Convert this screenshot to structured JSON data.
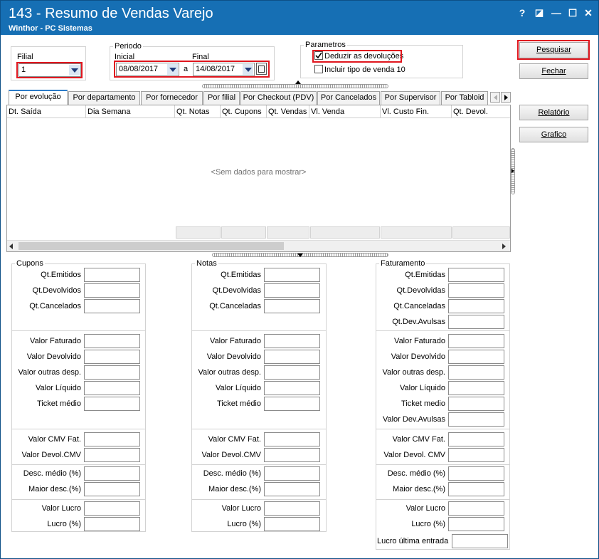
{
  "window": {
    "title": "143 - Resumo de Vendas Varejo",
    "subtitle": "Winthor - PC Sistemas",
    "buttons": [
      "?",
      "◪",
      "—",
      "☐",
      "✕"
    ]
  },
  "filial": {
    "label": "Filial",
    "value": "1"
  },
  "periodo": {
    "legend": "Periodo",
    "inicial_label": "Inicial",
    "inicial_value": "08/08/2017",
    "a_label": "a",
    "final_label": "Final",
    "final_value": "14/08/2017"
  },
  "parametros": {
    "legend": "Parametros",
    "deduzir_label": "Deduzir as devoluções",
    "deduzir_checked": true,
    "incluir_label": "Incluir tipo de venda 10",
    "incluir_checked": false
  },
  "buttons": {
    "pesquisar": "Pesquisar",
    "fechar": "Fechar",
    "relatorio": "Relatório",
    "grafico": "Grafico"
  },
  "tabs": [
    "Por evolução",
    "Por departamento",
    "Por fornecedor",
    "Por filial",
    "Por Checkout (PDV)",
    "Por Cancelados",
    "Por Supervisor",
    "Por Tabloid"
  ],
  "grid": {
    "columns": [
      "Dt. Saída",
      "Dia Semana",
      "Qt. Notas",
      "Qt. Cupons",
      "Qt. Vendas",
      "Vl. Venda",
      "Vl. Custo Fin.",
      "Qt. Devol."
    ],
    "empty_text": "<Sem dados para mostrar>"
  },
  "cupons": {
    "legend": "Cupons",
    "labels": [
      "Qt.Emitidos",
      "Qt.Devolvidos",
      "Qt.Cancelados",
      "Valor Faturado",
      "Valor Devolvido",
      "Valor outras desp.",
      "Valor Líquido",
      "Ticket médio",
      "Valor CMV Fat.",
      "Valor Devol.CMV",
      "Desc. médio (%)",
      "Maior desc.(%)",
      "Valor Lucro",
      "Lucro (%)"
    ]
  },
  "notas": {
    "legend": "Notas",
    "labels": [
      "Qt.Emitidas",
      "Qt.Devolvidas",
      "Qt.Canceladas",
      "Valor Faturado",
      "Valor Devolvido",
      "Valor outras desp.",
      "Valor Líquido",
      "Ticket médio",
      "Valor CMV Fat.",
      "Valor Devol.CMV",
      "Desc. médio (%)",
      "Maior desc.(%)",
      "Valor Lucro",
      "Lucro (%)"
    ]
  },
  "faturamento": {
    "legend": "Faturamento",
    "labels": [
      "Qt.Emitidas",
      "Qt.Devolvidas",
      "Qt.Canceladas",
      "Qt.Dev.Avulsas",
      "Valor Faturado",
      "Valor Devolvido",
      "Valor outras desp.",
      "Valor Líquido",
      "Ticket medio",
      "Valor Dev.Avulsas",
      "Valor CMV Fat.",
      "Valor Devol. CMV",
      "Desc. médio (%)",
      "Maior desc.(%)",
      "Valor Lucro",
      "Lucro (%)",
      "Lucro última entrada"
    ]
  }
}
